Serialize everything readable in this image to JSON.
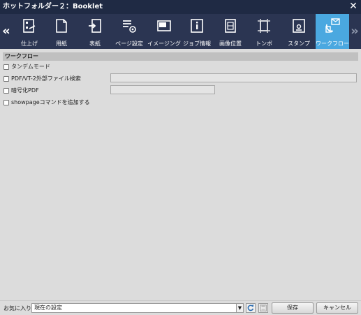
{
  "window": {
    "title": "ホットフォルダー２：Booklet",
    "close_symbol": "✕"
  },
  "toolbar": {
    "prev_symbol": "«",
    "next_symbol": "»",
    "tabs": [
      {
        "label": "仕上げ",
        "icon": "finishing-icon"
      },
      {
        "label": "用紙",
        "icon": "paper-icon"
      },
      {
        "label": "表紙",
        "icon": "cover-icon"
      },
      {
        "label": "ページ設定",
        "icon": "page-settings-icon"
      },
      {
        "label": "イメージング",
        "icon": "imaging-icon"
      },
      {
        "label": "ジョブ情報",
        "icon": "job-info-icon"
      },
      {
        "label": "画像位置",
        "icon": "image-position-icon"
      },
      {
        "label": "トンボ",
        "icon": "crop-marks-icon"
      },
      {
        "label": "スタンプ",
        "icon": "stamp-icon"
      },
      {
        "label": "ワークフロー",
        "icon": "workflow-icon",
        "active": true
      }
    ],
    "active_color": "#4aa8e0"
  },
  "section": {
    "title": "ワークフロー"
  },
  "options": {
    "tandem": {
      "label": "タンデムモード",
      "checked": false
    },
    "pdfvt": {
      "label": "PDF/VT-2外部ファイル検索",
      "checked": false,
      "value": ""
    },
    "encrypt": {
      "label": "暗号化PDF",
      "checked": false,
      "value": ""
    },
    "showpage": {
      "label": "showpageコマンドを追加する",
      "checked": false
    }
  },
  "footer": {
    "favorites_label": "お気に入り",
    "favorites_value": "現在の設定",
    "save_label": "保存",
    "cancel_label": "キャンセル"
  }
}
